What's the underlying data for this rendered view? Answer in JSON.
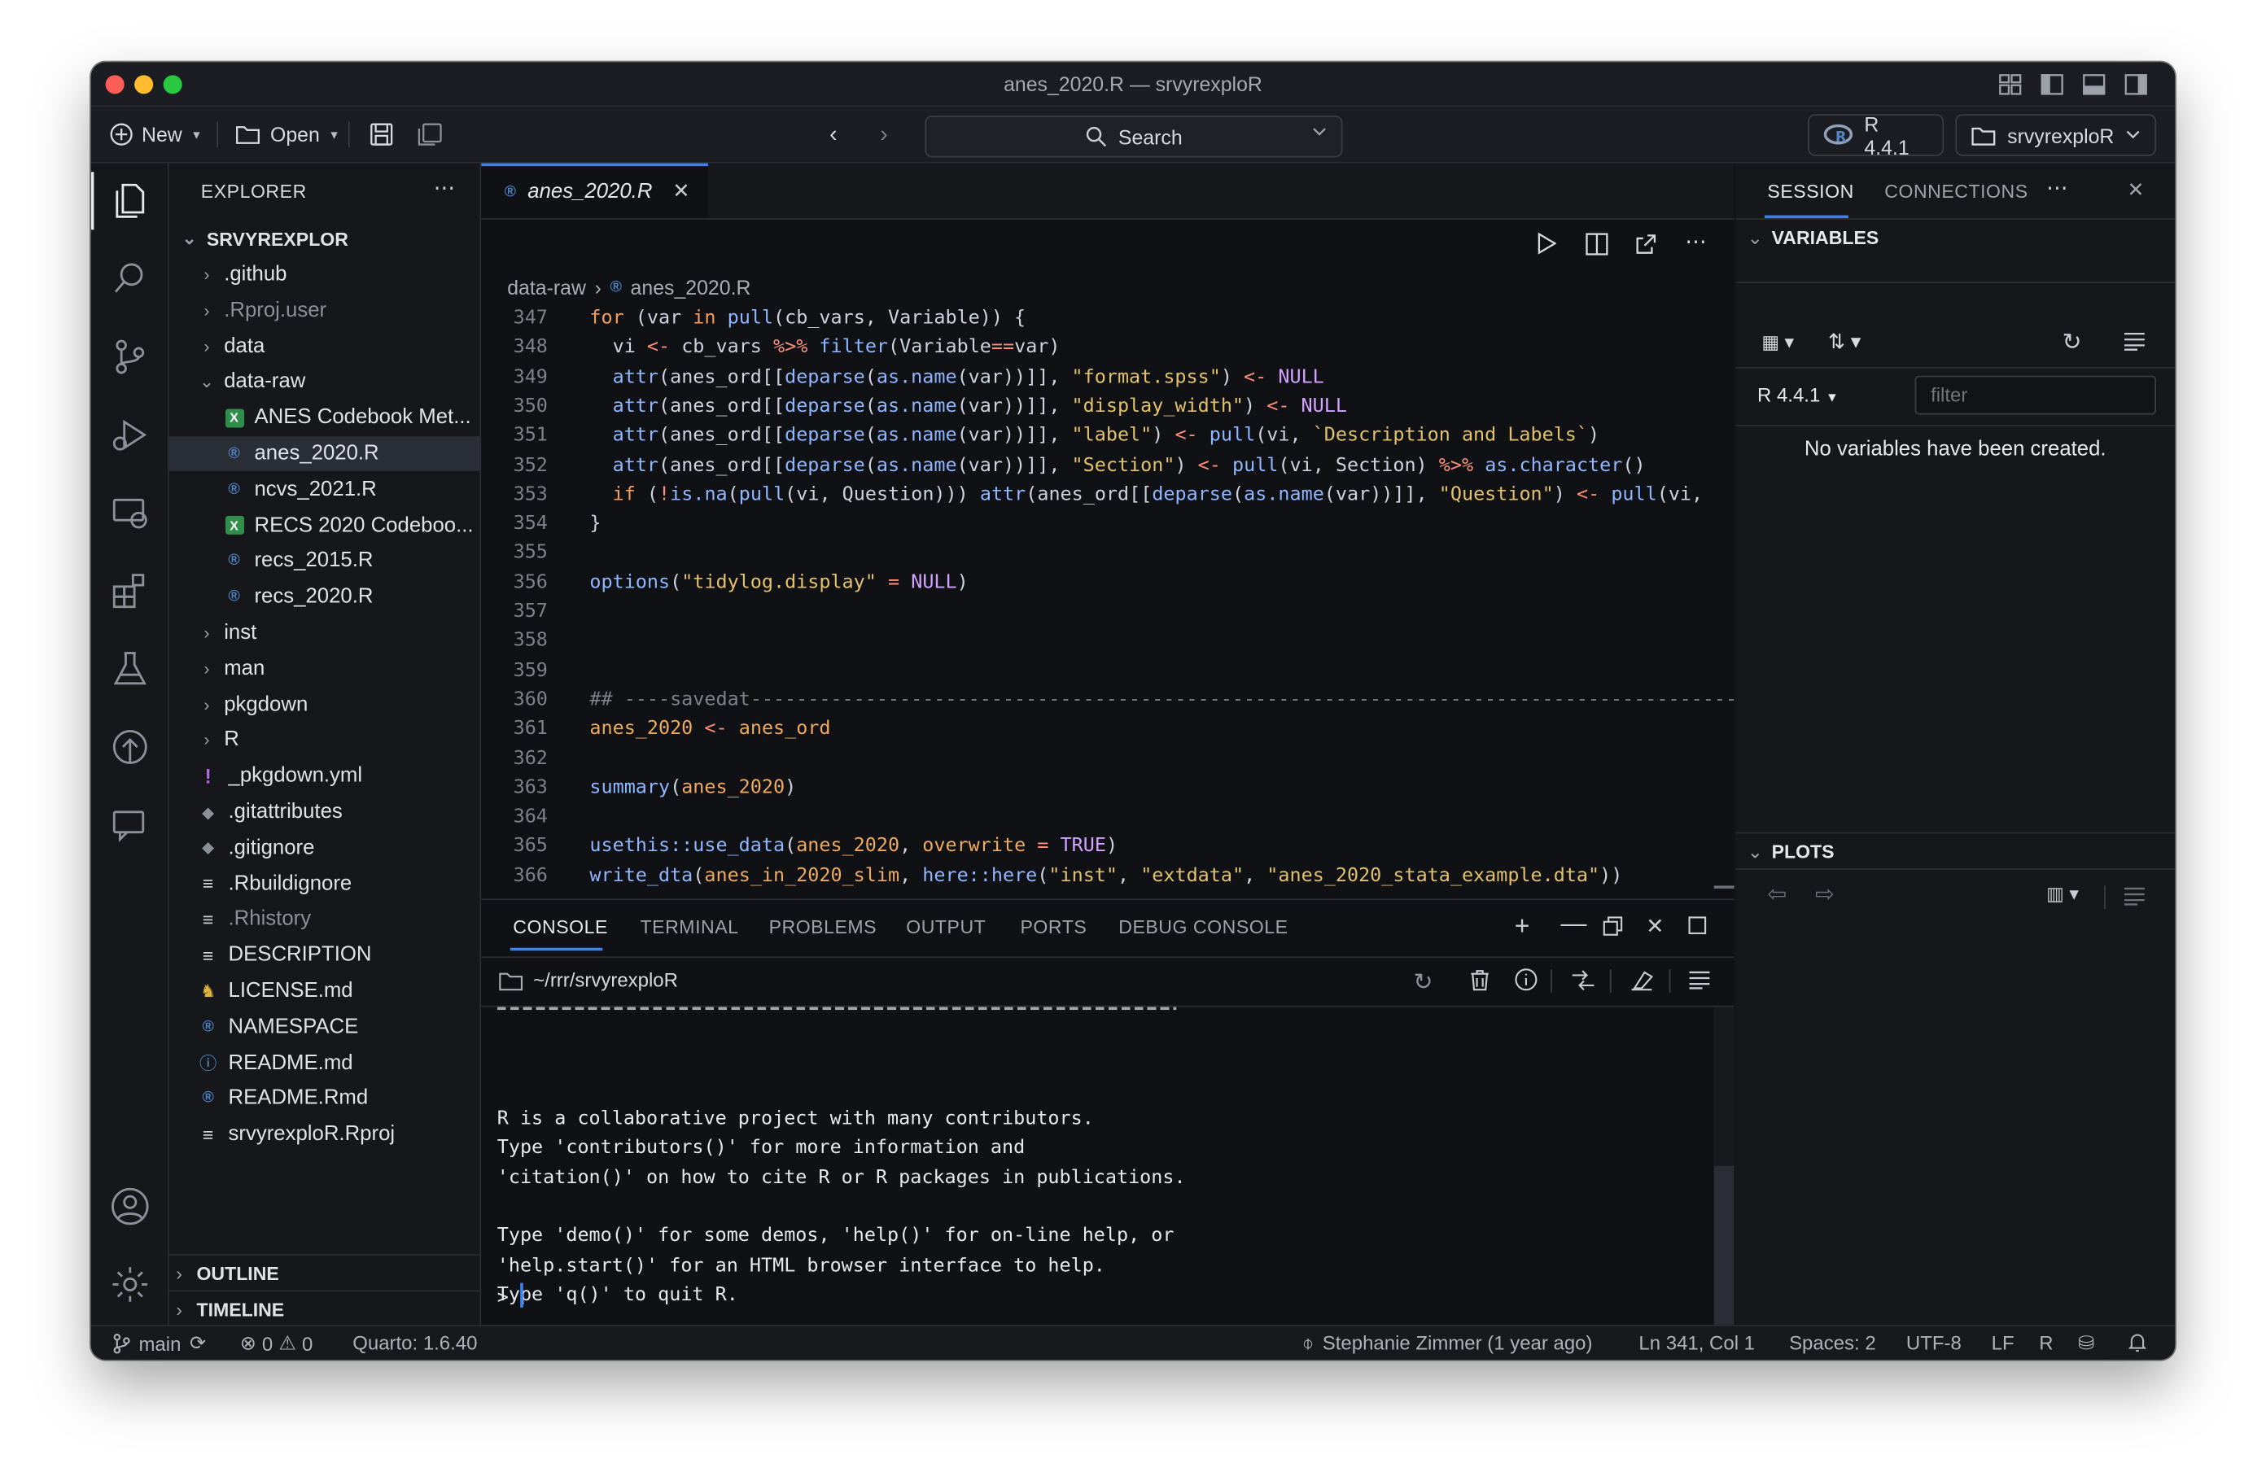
{
  "window": {
    "title": "anes_2020.R — srvyrexploR"
  },
  "toolbar": {
    "new_label": "New",
    "open_label": "Open",
    "search_label": "Search",
    "r_version": "R 4.4.1",
    "project": "srvyrexploR"
  },
  "explorer": {
    "header": "EXPLORER",
    "root": "SRVYREXPLOR",
    "items": [
      {
        "label": ".github",
        "type": "folder",
        "dim": false
      },
      {
        "label": ".Rproj.user",
        "type": "folder",
        "dim": true
      },
      {
        "label": "data",
        "type": "folder",
        "dim": false
      },
      {
        "label": "data-raw",
        "type": "folder-open",
        "dim": false
      },
      {
        "label": "ANES Codebook Met...",
        "type": "excel",
        "dim": false
      },
      {
        "label": "anes_2020.R",
        "type": "r",
        "dim": false
      },
      {
        "label": "ncvs_2021.R",
        "type": "r",
        "dim": false
      },
      {
        "label": "RECS 2020 Codeboo...",
        "type": "excel",
        "dim": false
      },
      {
        "label": "recs_2015.R",
        "type": "r",
        "dim": false
      },
      {
        "label": "recs_2020.R",
        "type": "r",
        "dim": false
      },
      {
        "label": "inst",
        "type": "folder",
        "dim": false
      },
      {
        "label": "man",
        "type": "folder",
        "dim": false
      },
      {
        "label": "pkgdown",
        "type": "folder",
        "dim": false
      },
      {
        "label": "R",
        "type": "folder",
        "dim": false
      },
      {
        "label": "_pkgdown.yml",
        "type": "yml",
        "dim": false
      },
      {
        "label": ".gitattributes",
        "type": "git",
        "dim": false
      },
      {
        "label": ".gitignore",
        "type": "git",
        "dim": false
      },
      {
        "label": ".Rbuildignore",
        "type": "text",
        "dim": false
      },
      {
        "label": ".Rhistory",
        "type": "text",
        "dim": true
      },
      {
        "label": "DESCRIPTION",
        "type": "text",
        "dim": false
      },
      {
        "label": "LICENSE.md",
        "type": "license",
        "dim": false
      },
      {
        "label": "NAMESPACE",
        "type": "r",
        "dim": false
      },
      {
        "label": "README.md",
        "type": "info",
        "dim": false
      },
      {
        "label": "README.Rmd",
        "type": "r",
        "dim": false
      },
      {
        "label": "srvyrexploR.Rproj",
        "type": "text",
        "dim": false
      }
    ],
    "outline": "OUTLINE",
    "timeline": "TIMELINE"
  },
  "editor": {
    "tab_label": "anes_2020.R",
    "breadcrumb": [
      "data-raw",
      "anes_2020.R"
    ],
    "lines": [
      {
        "n": "347",
        "html": "<span class='kw'>for</span> (var <span class='kw'>in</span> <span class='fn'>pull</span>(cb_vars, Variable)) {"
      },
      {
        "n": "348",
        "html": "  vi <span class='op'>&lt;-</span> cb_vars <span class='op'>%&gt;%</span> <span class='fn'>filter</span>(Variable<span class='op'>==</span>var)"
      },
      {
        "n": "349",
        "html": "  <span class='fn'>attr</span>(anes_ord[[<span class='fn'>deparse</span>(<span class='fn'>as.name</span>(var))]], <span class='st'>\"format.spss\"</span>) <span class='op'>&lt;-</span> <span class='nu'>NULL</span>"
      },
      {
        "n": "350",
        "html": "  <span class='fn'>attr</span>(anes_ord[[<span class='fn'>deparse</span>(<span class='fn'>as.name</span>(var))]], <span class='st'>\"display_width\"</span>) <span class='op'>&lt;-</span> <span class='nu'>NULL</span>"
      },
      {
        "n": "351",
        "html": "  <span class='fn'>attr</span>(anes_ord[[<span class='fn'>deparse</span>(<span class='fn'>as.name</span>(var))]], <span class='st'>\"label\"</span>) <span class='op'>&lt;-</span> <span class='fn'>pull</span>(vi, <span class='st'>`Description and Labels`</span>)"
      },
      {
        "n": "352",
        "html": "  <span class='fn'>attr</span>(anes_ord[[<span class='fn'>deparse</span>(<span class='fn'>as.name</span>(var))]], <span class='st'>\"Section\"</span>) <span class='op'>&lt;-</span> <span class='fn'>pull</span>(vi, Section) <span class='op'>%&gt;%</span> <span class='fn'>as.character</span>()"
      },
      {
        "n": "353",
        "html": "  <span class='kw'>if</span> (<span class='op'>!</span><span class='fn'>is.na</span>(<span class='fn'>pull</span>(vi, Question))) <span class='fn'>attr</span>(anes_ord[[<span class='fn'>deparse</span>(<span class='fn'>as.name</span>(var))]], <span class='st'>\"Question\"</span>) <span class='op'>&lt;-</span> <span class='fn'>pull</span>(vi,"
      },
      {
        "n": "354",
        "html": "}"
      },
      {
        "n": "355",
        "html": ""
      },
      {
        "n": "356",
        "html": "<span class='fn'>options</span>(<span class='st'>\"tidylog.display\"</span> <span class='op'>=</span> <span class='nu'>NULL</span>)"
      },
      {
        "n": "357",
        "html": ""
      },
      {
        "n": "358",
        "html": ""
      },
      {
        "n": "359",
        "html": ""
      },
      {
        "n": "360",
        "html": "<span class='cm'>## ----savedat--------------------------------------------------------------------------------------------------</span>"
      },
      {
        "n": "361",
        "html": "<span class='id'>anes_2020</span> <span class='op'>&lt;-</span> <span class='id'>anes_ord</span>"
      },
      {
        "n": "362",
        "html": ""
      },
      {
        "n": "363",
        "html": "<span class='fn'>summary</span>(<span class='id'>anes_2020</span>)"
      },
      {
        "n": "364",
        "html": ""
      },
      {
        "n": "365",
        "html": "<span class='fn'>usethis::use_data</span>(<span class='id'>anes_2020</span>, <span class='id'>overwrite</span> <span class='op'>=</span> <span class='nu'>TRUE</span>)"
      },
      {
        "n": "366",
        "html": "<span class='fn'>write_dta</span>(<span class='id'>anes_in_2020_slim</span>, <span class='fn'>here::here</span>(<span class='st'>\"inst\"</span>, <span class='st'>\"extdata\"</span>, <span class='st'>\"anes_2020_stata_example.dta\"</span>))"
      }
    ]
  },
  "panel": {
    "tabs": [
      "CONSOLE",
      "TERMINAL",
      "PROBLEMS",
      "OUTPUT",
      "PORTS",
      "DEBUG CONSOLE"
    ],
    "path": "~/rrr/srvyrexploR",
    "console_lines": [
      "R is a collaborative project with many contributors.",
      "Type 'contributors()' for more information and",
      "'citation()' on how to cite R or R packages in publications.",
      "",
      "Type 'demo()' for some demos, 'help()' for on-line help, or",
      "'help.start()' for an HTML browser interface to help.",
      "Type 'q()' to quit R."
    ],
    "prompt": ">"
  },
  "session": {
    "tabs": [
      "SESSION",
      "CONNECTIONS"
    ],
    "variables_header": "VARIABLES",
    "r_selector": "R 4.4.1",
    "filter_placeholder": "filter",
    "empty_message": "No variables have been created.",
    "plots_header": "PLOTS"
  },
  "statusbar": {
    "branch": "main",
    "errors": "0",
    "warnings": "0",
    "quarto": "Quarto: 1.6.40",
    "blame": "Stephanie Zimmer (1 year ago)",
    "position": "Ln 341, Col 1",
    "spaces": "Spaces: 2",
    "encoding": "UTF-8",
    "eol": "LF",
    "language": "R"
  },
  "colors": {
    "accent": "#3b82f6",
    "background": "#111317",
    "r_blue": "#4f86c6",
    "excel_green": "#3aa657"
  }
}
